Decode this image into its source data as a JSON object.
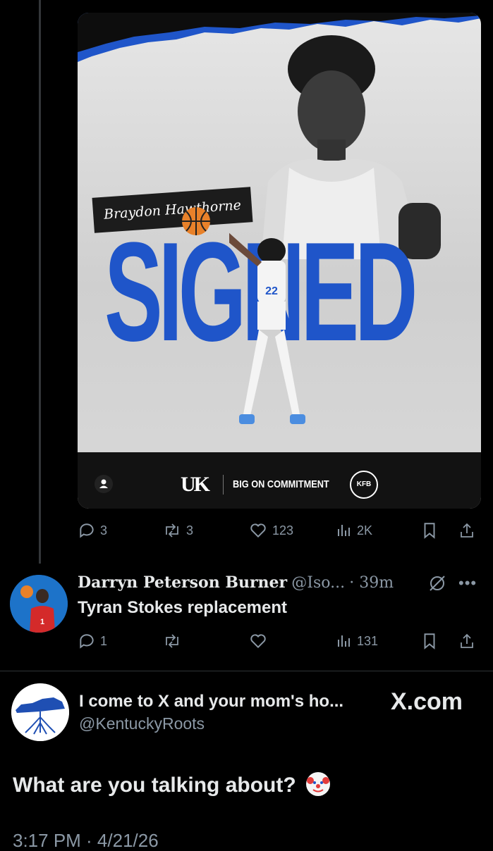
{
  "media": {
    "player_name": "Braydon Hawthorne",
    "headline": "SIGNED",
    "brand_line": "BIG ON COMMITMENT",
    "uk_logo": "UK",
    "kfb_logo": "KFB",
    "accent_color": "#1f55c9",
    "alt_icon": "person-icon"
  },
  "post_actions": {
    "replies": "3",
    "reposts": "3",
    "likes": "123",
    "views": "2K"
  },
  "reply": {
    "name": "Darryn Peterson Burner",
    "handle": "@Iso...",
    "time": "· 39m",
    "text": "Tyran Stokes replacement",
    "replies": "1",
    "views": "131"
  },
  "main_post": {
    "name": "I come to X and your mom's ho...",
    "handle": "@KentuckyRoots",
    "source": "X.com",
    "text": "What are you talking about?",
    "emoji": "clown-emoji",
    "timestamp": "3:17 PM · 4/21/26"
  }
}
